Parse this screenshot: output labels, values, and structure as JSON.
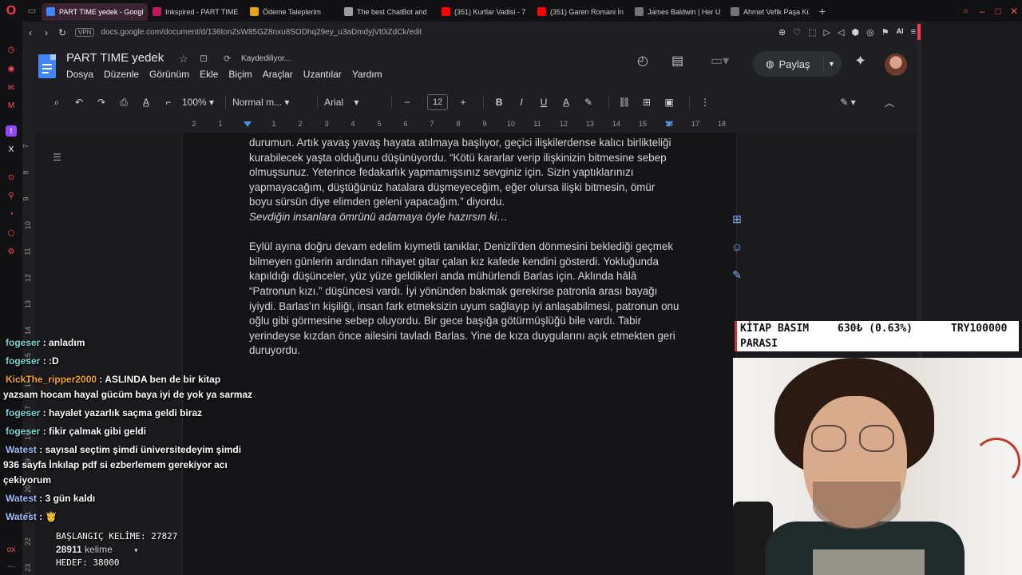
{
  "browser": {
    "tabs": [
      {
        "title": "PART TIME yedek - Google",
        "color": "#4285f4",
        "active": true
      },
      {
        "title": "Inkspired - PART TIME",
        "color": "#c2185b",
        "active": false
      },
      {
        "title": "Ödeme Taleplerim",
        "color": "#e8a317",
        "active": false
      },
      {
        "title": "The best ChatBot and",
        "color": "#9e9e9e",
        "active": false
      },
      {
        "title": "(351) Kurtlar Vadisi - 7",
        "color": "#ff0000",
        "active": false
      },
      {
        "title": "(351) Garen Romani İn",
        "color": "#ff0000",
        "active": false
      },
      {
        "title": "James Baldwin | Her U",
        "color": "#757575",
        "active": false
      },
      {
        "title": "Ahmet Vefik Paşa Kütü",
        "color": "#757575",
        "active": false
      }
    ],
    "new_tab": "+",
    "vpn": "VPN",
    "url": "docs.google.com/document/d/136tonZsW85GZ8nxu8SODhq29ey_u3aDmdyjVt0iZdCk/edit",
    "ai_label": "AI"
  },
  "docs": {
    "title": "PART TIME  yedek",
    "saving": "Kaydediliyor...",
    "menu": [
      "Dosya",
      "Düzenle",
      "Görünüm",
      "Ekle",
      "Biçim",
      "Araçlar",
      "Uzantılar",
      "Yardım"
    ],
    "share": "Paylaş",
    "zoom": "100%",
    "style": "Normal m...",
    "font": "Arial",
    "font_size": "12",
    "ruler_ticks": [
      "2",
      "1",
      "1",
      "2",
      "3",
      "4",
      "5",
      "6",
      "7",
      "8",
      "9",
      "10",
      "11",
      "12",
      "13",
      "14",
      "15",
      "16",
      "17",
      "18"
    ],
    "vruler_ticks": [
      "7",
      "8",
      "9",
      "10",
      "11",
      "12",
      "13",
      "14",
      "15",
      "16",
      "17",
      "18",
      "19",
      "20",
      "21",
      "22",
      "23"
    ],
    "paragraphs": [
      "durumun. Artık yavaş yavaş hayata atılmaya başlıyor, geçici ilişkilerdense kalıcı birlikteliği kurabilecek yaşta olduğunu düşünüyordu. “Kötü kararlar verip ilişkinizin bitmesine sebep olmuşsunuz. Yeterince fedakarlık yapmamışsınız sevginiz için. Sizin yaptıklarınızı yapmayacağım, düştüğünüz hatalara düşmeyeceğim, eğer olursa ilişki bitmesin, ömür boyu sürsün diye elimden geleni yapacağım.” diyordu.",
      "Sevdiğin insanlara ömrünü adamaya öyle hazırsın ki…",
      "Eylül ayına doğru devam edelim kıymetli tanıklar, Denizli'den dönmesini beklediği geçmek bilmeyen günlerin ardından nihayet gitar çalan kız kafede kendini gösterdi. Yokluğunda kapıldığı düşünceler, yüz yüze geldikleri anda mühürlendi Barlas için. Aklında hâlâ “Patronun kızı.” düşüncesi vardı. İyi yönünden bakmak gerekirse patronla arası bayağı iyiydi. Barlas'ın kişiliği, insan fark etmeksizin uyum sağlayıp iyi anlaşabilmesi, patronun onu oğlu gibi görmesine sebep oluyordu. Bir gece başığa götürmüşlüğü bile vardı. Tabir yerindeyse kızdan önce ailesini tavladı Barlas. Yine de kıza duygularını açık etmekten geri duruyordu."
    ]
  },
  "stream": {
    "chat": [
      {
        "user": "fogeser",
        "color": "#7ad6d6",
        "text": "anladım"
      },
      {
        "user": "fogeser",
        "color": "#7ad6d6",
        "text": ":D"
      },
      {
        "user": "KickThe_ripper2000",
        "color": "#f5a623",
        "text": "ASLINDA ben de bir kitap yazsam hocam hayal gücüm baya iyi de yok ya sarmaz"
      },
      {
        "user": "fogeser",
        "color": "#7ad6d6",
        "text": "hayalet yazarlık saçma geldi biraz"
      },
      {
        "user": "fogeser",
        "color": "#7ad6d6",
        "text": "fikir çalmak gibi geldi"
      },
      {
        "user": "Watest",
        "color": "#9ec1ff",
        "text": "sayısal seçtim şimdi üniversitedeyim şimdi 936 sayfa İnkılap pdf si ezberlemem gerekiyor acı çekiyorum"
      },
      {
        "user": "Watest",
        "color": "#9ec1ff",
        "text": "3 gün kaldı"
      },
      {
        "user": "Watest",
        "color": "#9ec1ff",
        "text": "🤴"
      }
    ],
    "word_start": "BAŞLANGIÇ KELİME: 27827",
    "docs_word_count": "28911",
    "docs_word_label": "kelime",
    "word_goal": "HEDEF: 38000",
    "ticker": {
      "line1": "KİTAP BASIM",
      "line2": "PARASI",
      "amount": "630₺ (0.63%)",
      "goal": "TRY100000"
    }
  }
}
